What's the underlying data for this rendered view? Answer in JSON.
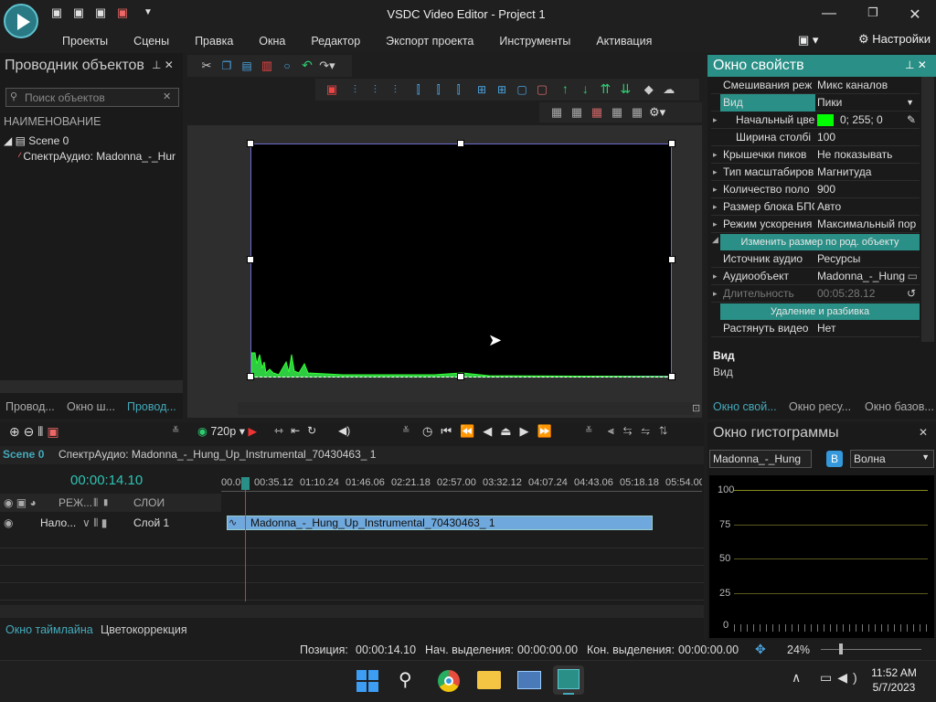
{
  "window": {
    "title": "VSDC Video Editor - Project 1"
  },
  "menu": [
    "Проекты",
    "Сцены",
    "Правка",
    "Окна",
    "Редактор",
    "Экспорт проекта",
    "Инструменты",
    "Активация"
  ],
  "settings_label": "Настройки",
  "left_panel": {
    "title": "Проводник объектов",
    "search_placeholder": "Поиск объектов",
    "column_header": "НАИМЕНОВАНИЕ",
    "tree": [
      "Scene 0",
      "СпектрАудио: Madonna_-_Hur"
    ],
    "tabs": [
      "Провод...",
      "Окно ш...",
      "Провод..."
    ]
  },
  "properties": {
    "title": "Окно свойств",
    "rows": [
      {
        "k": "Смешивания реж",
        "v": "Микс каналов"
      },
      {
        "k": "Вид",
        "v": "Пики"
      },
      {
        "k": "Начальный цве",
        "v": "0; 255; 0"
      },
      {
        "k": "Ширина столбі",
        "v": "100"
      },
      {
        "k": "Крышечки пиков",
        "v": "Не показывать"
      },
      {
        "k": "Тип масштабиров",
        "v": "Магнитуда"
      },
      {
        "k": "Количество поло",
        "v": "900"
      },
      {
        "k": "Размер блока БПО",
        "v": "Авто"
      },
      {
        "k": "Режим ускорения",
        "v": "Максимальный пор"
      }
    ],
    "btn1": "Изменить размер по род. объекту",
    "rows2": [
      {
        "k": "Источник аудио",
        "v": "Ресурсы"
      },
      {
        "k": "Аудиообъект",
        "v": "Madonna_-_Hung"
      },
      {
        "k": "Длительность",
        "v": "00:05:28.12"
      }
    ],
    "btn2": "Удаление и разбивка",
    "rows3": [
      {
        "k": "Растянуть видео",
        "v": "Нет"
      }
    ],
    "desc_title": "Вид",
    "desc_text": "Вид",
    "tabs": [
      "Окно свой...",
      "Окно ресу...",
      "Окно базов..."
    ]
  },
  "histogram": {
    "title": "Окно гистограммы",
    "source": "Madonna_-_Hung",
    "mode": "Волна",
    "b_label": "B",
    "scale": [
      "100",
      "75",
      "50",
      "25",
      "0"
    ]
  },
  "timeline": {
    "resolution": "720p",
    "tabs": [
      "Scene 0",
      "СпектрАудио: Madonna_-_Hung_Up_Instrumental_70430463_ 1"
    ],
    "time": "00:00:14.10",
    "ruler": [
      "00.00",
      "00:35.12",
      "01:10.24",
      "01:46.06",
      "02:21.18",
      "02:57.00",
      "03:32.12",
      "04:07.24",
      "04:43.06",
      "05:18.18",
      "05:54.00"
    ],
    "header_mode": "РЕЖ...",
    "header_layers": "СЛОИ",
    "layer_mode": "Нало...",
    "layer_name": "Слой 1",
    "clip": "Madonna_-_Hung_Up_Instrumental_70430463_ 1",
    "bottom_tabs": [
      "Окно таймлайна",
      "Цветокоррекция"
    ]
  },
  "status": {
    "pos_label": "Позиция:",
    "pos": "00:00:14.10",
    "sel_start_label": "Нач. выделения:",
    "sel_start": "00:00:00.00",
    "sel_end_label": "Кон. выделения:",
    "sel_end": "00:00:00.00",
    "zoom": "24%"
  },
  "taskbar": {
    "time": "11:52 AM",
    "date": "5/7/2023"
  }
}
